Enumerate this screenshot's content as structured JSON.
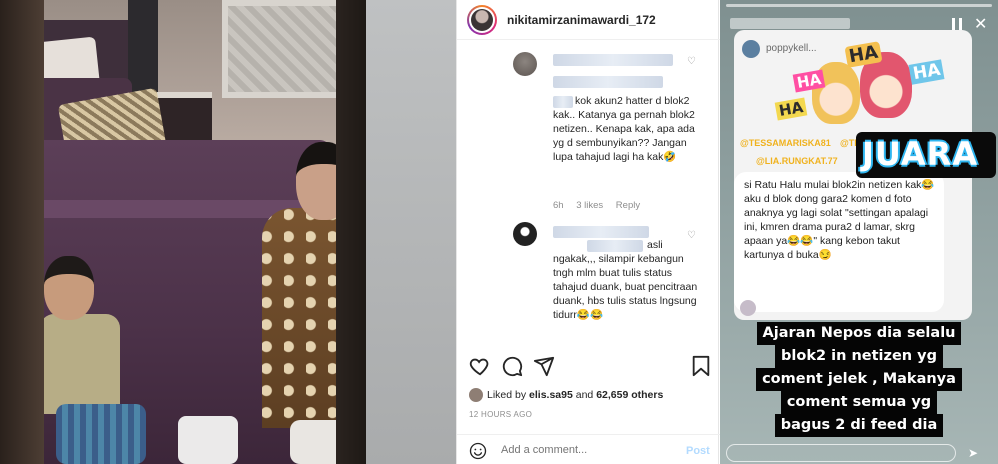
{
  "instagram": {
    "username": "nikitamirzanimawardi_172",
    "comments": [
      {
        "text": "kok akun2 hatter d blok2 kak.. Katanya ga pernah blok2 netizen.. Kenapa kak, apa ada yg d sembunyikan?? Jangan lupa tahajud lagi ha kak🤣",
        "age": "6h",
        "likes": "3 likes",
        "reply_label": "Reply"
      },
      {
        "text": "asli ngakak,,, silampir kebangun tngh mlm buat tulis status tahajud duank, buat pencitraan duank, hbs tulis status lngsung tidurr😂😂"
      }
    ],
    "liked_by_prefix": "Liked by",
    "liked_by_user": "elis.sa95",
    "liked_by_and": "and",
    "liked_by_others": "62,659 others",
    "time_ago": "12 HOURS AGO",
    "comment_placeholder": "Add a comment...",
    "post_label": "Post",
    "icons": [
      "heart-icon",
      "comment-icon",
      "share-icon",
      "bookmark-icon",
      "smile-icon"
    ]
  },
  "story": {
    "poppy_handle": "poppykell...",
    "haha_words": [
      "HA",
      "HA",
      "HA",
      "HA"
    ],
    "tags": [
      "@TESSAMARISKA81",
      "@THE",
      "@LIA.RUNGKAT.77"
    ],
    "juara": "JUARA",
    "bubble_text": "si Ratu Halu mulai blok2in netizen kak😂 aku d blok dong gara2 komen d foto anaknya yg lagi solat \"settingan apalagi ini, kmren drama pura2 d lamar, skrg apaan ya😂😂\" kang kebon takut kartunya d buka😏",
    "caption_lines": [
      "Ajaran Nepos dia selalu",
      "blok2 in netizen yg",
      "coment jelek , Makanya",
      "coment semua yg",
      "bagus 2 di feed dia"
    ]
  },
  "colors": {
    "ig_text": "#262626",
    "ig_muted": "#8e8e8e",
    "post_disabled": "#b3dbff",
    "juara_outline": "#2fb6f0",
    "caption_bg": "#050505"
  }
}
